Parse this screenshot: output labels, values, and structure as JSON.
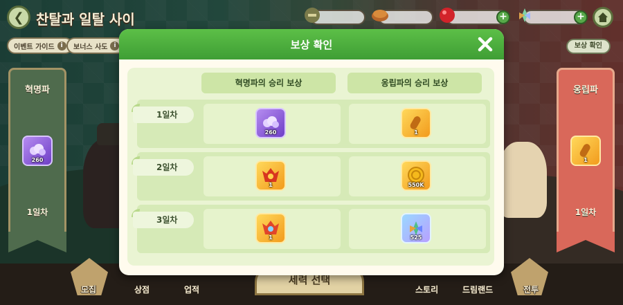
{
  "header": {
    "title": "찬탈과 일탈 사이",
    "event_guide_label": "이벤트 가이드",
    "bonus_cookie_label": "보너스 사도",
    "reward_check_label": "보상 확인"
  },
  "factions": {
    "left": {
      "name": "혁명파",
      "item_qty": "260",
      "day": "1일차"
    },
    "right": {
      "name": "옹립파",
      "item_qty": "1",
      "day": "1일차"
    }
  },
  "bottom_nav": {
    "recruit": "모집",
    "shop": "상점",
    "achievements": "업적",
    "faction_select": "세력 선택",
    "story": "스토리",
    "dreamland": "드림랜드",
    "battle": "전투"
  },
  "modal": {
    "title": "보상 확인",
    "columns": [
      "혁명파의 승리 보상",
      "옹립파의 승리 보상"
    ],
    "rows": [
      {
        "day": "1일차",
        "left": {
          "icon": "purple-crystal-icon",
          "qty": "260"
        },
        "right": {
          "icon": "golden-bread-icon",
          "qty": "1"
        }
      },
      {
        "day": "2일차",
        "left": {
          "icon": "flame-crest-icon",
          "qty": "1"
        },
        "right": {
          "icon": "gold-coin-icon",
          "qty": "550K"
        }
      },
      {
        "day": "3일차",
        "left": {
          "icon": "flame-crest-sparkle-icon",
          "qty": "1"
        },
        "right": {
          "icon": "crystal-leaf-icon",
          "qty": "525"
        }
      }
    ]
  },
  "colors": {
    "modal_header": "#4caf3f",
    "modal_body": "#eaf4d3",
    "left_faction": "#4f6b4d",
    "right_faction": "#d9685a"
  }
}
